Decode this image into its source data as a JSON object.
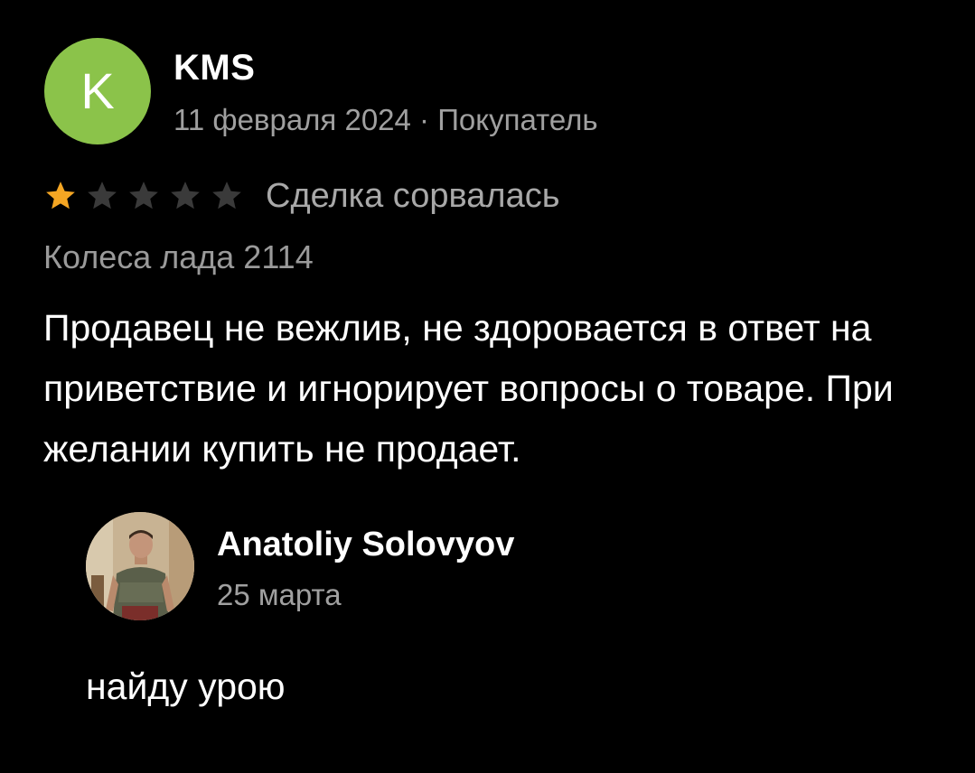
{
  "colors": {
    "background": "#000000",
    "avatar_bg": "#8bc34a",
    "star_filled": "#f5a623",
    "star_empty": "#3a3a3a",
    "secondary_text": "#a0a0a0"
  },
  "review": {
    "avatar_letter": "K",
    "author": "KMS",
    "meta": "11 февраля 2024 · Покупатель",
    "rating": 1,
    "rating_max": 5,
    "deal_status": "Сделка сорвалась",
    "product": "Колеса лада 2114",
    "text": "Продавец не вежлив, не здоровается в ответ на приветствие и игнорирует вопросы о товаре. При желании купить не продает."
  },
  "reply": {
    "author": "Anatoliy Solovyov",
    "date": "25 марта",
    "text": "найду урою",
    "avatar_icon": "user-photo"
  }
}
